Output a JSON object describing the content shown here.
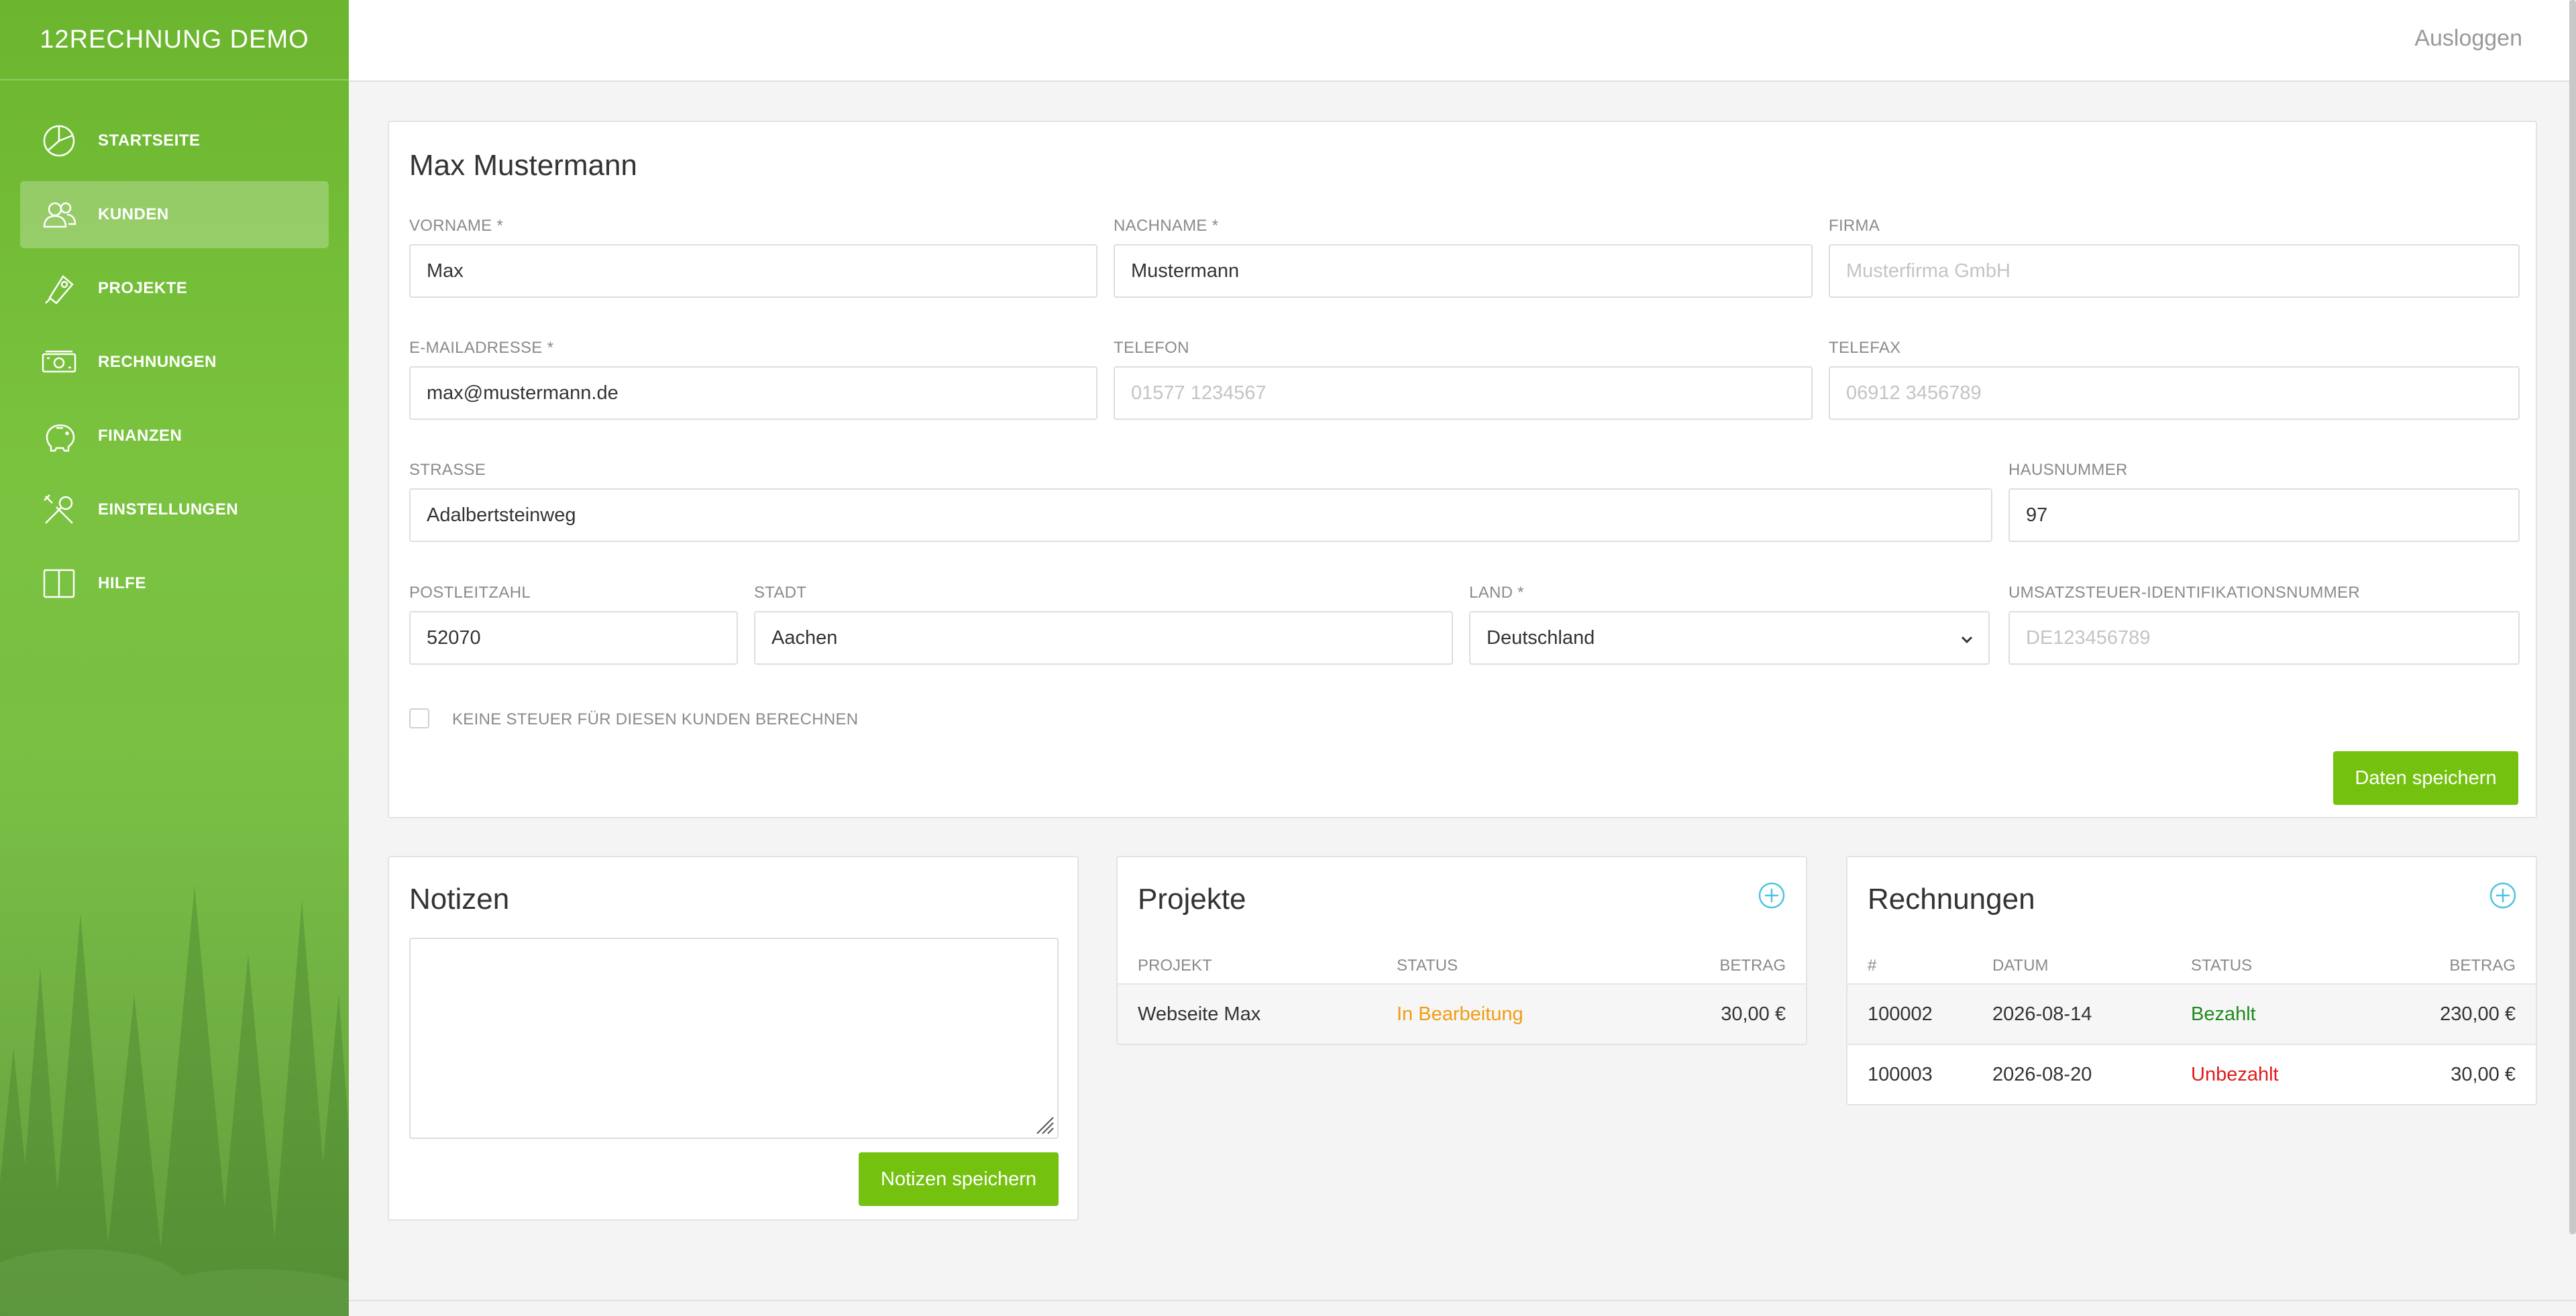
{
  "app": {
    "title": "12RECHNUNG DEMO"
  },
  "sidebar": {
    "items": [
      {
        "label": "STARTSEITE",
        "icon": "dashboard-icon"
      },
      {
        "label": "KUNDEN",
        "icon": "users-icon",
        "active": true
      },
      {
        "label": "PROJEKTE",
        "icon": "projects-icon"
      },
      {
        "label": "RECHNUNGEN",
        "icon": "invoice-icon"
      },
      {
        "label": "FINANZEN",
        "icon": "piggy-bank-icon"
      },
      {
        "label": "EINSTELLUNGEN",
        "icon": "tools-icon"
      },
      {
        "label": "HILFE",
        "icon": "book-icon"
      }
    ]
  },
  "header": {
    "logout": "Ausloggen"
  },
  "customer": {
    "title": "Max Mustermann",
    "fields": {
      "vorname": {
        "label": "VORNAME *",
        "value": "Max"
      },
      "nachname": {
        "label": "NACHNAME *",
        "value": "Mustermann"
      },
      "firma": {
        "label": "FIRMA",
        "placeholder": "Musterfirma GmbH"
      },
      "email": {
        "label": "E-MAILADRESSE *",
        "value": "max@mustermann.de"
      },
      "telefon": {
        "label": "TELEFON",
        "placeholder": "01577 1234567"
      },
      "telefax": {
        "label": "TELEFAX",
        "placeholder": "06912 3456789"
      },
      "strasse": {
        "label": "STRASSE",
        "value": "Adalbertsteinweg"
      },
      "hausnummer": {
        "label": "HAUSNUMMER",
        "value": "97"
      },
      "plz": {
        "label": "POSTLEITZAHL",
        "value": "52070"
      },
      "stadt": {
        "label": "STADT",
        "value": "Aachen"
      },
      "land": {
        "label": "LAND *",
        "value": "Deutschland"
      },
      "ust": {
        "label": "UMSATZSTEUER-IDENTIFIKATIONSNUMMER",
        "placeholder": "DE123456789"
      }
    },
    "no_tax_label": "KEINE STEUER FÜR DIESEN KUNDEN BERECHNEN",
    "save_label": "Daten speichern"
  },
  "notes": {
    "title": "Notizen",
    "save_label": "Notizen speichern"
  },
  "projects": {
    "title": "Projekte",
    "columns": [
      "PROJEKT",
      "STATUS",
      "BETRAG"
    ],
    "rows": [
      {
        "name": "Webseite Max",
        "status": "In Bearbeitung",
        "amount": "30,00 €"
      }
    ],
    "status_color": "#f39c12"
  },
  "invoices": {
    "title": "Rechnungen",
    "columns": [
      "#",
      "DATUM",
      "STATUS",
      "BETRAG"
    ],
    "rows": [
      {
        "number": "100002",
        "date": "2026-08-14",
        "status": "Bezahlt",
        "amount": "230,00 €"
      },
      {
        "number": "100003",
        "date": "2026-08-20",
        "status": "Unbezahlt",
        "amount": "30,00 €"
      }
    ],
    "paid_color": "#1e8a1e",
    "unpaid_color": "#e01b1b"
  },
  "colors": {
    "accent": "#74c20f",
    "plus": "#4cc3e0"
  }
}
